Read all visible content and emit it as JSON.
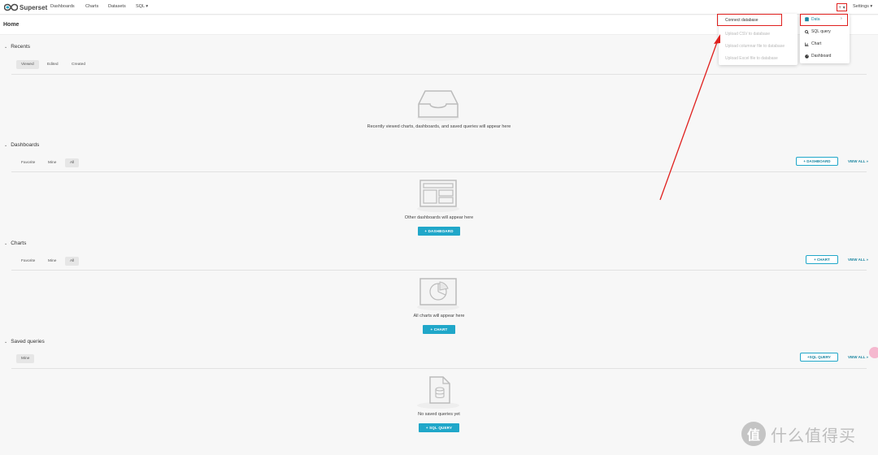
{
  "nav": {
    "brand": "Superset",
    "items": [
      "Dashboards",
      "Charts",
      "Datasets",
      "SQL ▾"
    ],
    "plus_label": "+ ▾",
    "settings_label": "Settings ▾"
  },
  "page_title": "Home",
  "recents": {
    "title": "Recents",
    "tabs": [
      "Viewed",
      "Edited",
      "Created"
    ],
    "empty_text": "Recently viewed charts, dashboards, and saved queries will appear here"
  },
  "dashboards": {
    "title": "Dashboards",
    "tabs": [
      "Favorite",
      "Mine",
      "All"
    ],
    "add_label": "+ DASHBOARD",
    "view_all": "VIEW ALL »",
    "empty_text": "Other dashboards will appear here",
    "cta_label": "+ DASHBOARD"
  },
  "charts": {
    "title": "Charts",
    "tabs": [
      "Favorite",
      "Mine",
      "All"
    ],
    "add_label": "+ CHART",
    "view_all": "VIEW ALL »",
    "empty_text": "All charts will appear here",
    "cta_label": "+ CHART"
  },
  "saved_queries": {
    "title": "Saved queries",
    "tabs": [
      "Mine"
    ],
    "add_label": "+SQL QUERY",
    "view_all": "VIEW ALL »",
    "empty_text": "No saved queries yet",
    "cta_label": "+ SQL QUERY"
  },
  "data_submenu": {
    "items": [
      {
        "label": "Connect database",
        "enabled": true
      },
      {
        "label": "Upload CSV to database",
        "enabled": false
      },
      {
        "label": "Upload columnar file to database",
        "enabled": false
      },
      {
        "label": "Upload Excel file to database",
        "enabled": false
      }
    ]
  },
  "plus_menu": {
    "items": [
      {
        "label": "Data",
        "icon": "database-icon"
      },
      {
        "label": "SQL query",
        "icon": "search-icon"
      },
      {
        "label": "Chart",
        "icon": "bar-chart-icon"
      },
      {
        "label": "Dashboard",
        "icon": "dashboard-icon"
      }
    ]
  },
  "watermark": {
    "badge": "值",
    "text": "什么值得买"
  },
  "colors": {
    "accent": "#20a7c9",
    "annotation_red": "#e0201e"
  }
}
